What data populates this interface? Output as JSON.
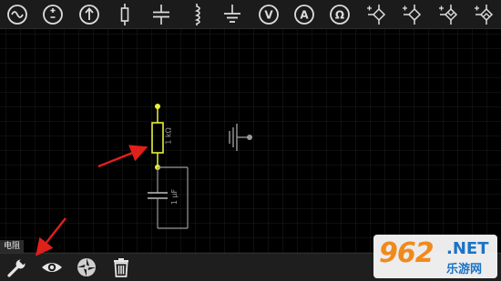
{
  "toolbar": {
    "items": [
      {
        "name": "ac-source-icon"
      },
      {
        "name": "dc-source-icon"
      },
      {
        "name": "current-source-icon"
      },
      {
        "name": "resistor-icon"
      },
      {
        "name": "capacitor-icon"
      },
      {
        "name": "inductor-icon"
      },
      {
        "name": "ground-icon"
      },
      {
        "name": "voltmeter-icon"
      },
      {
        "name": "ammeter-icon"
      },
      {
        "name": "ohmmeter-icon"
      },
      {
        "name": "npn-transistor-icon"
      },
      {
        "name": "pnp-transistor-icon"
      },
      {
        "name": "n-mosfet-icon"
      },
      {
        "name": "p-mosfet-icon"
      }
    ],
    "labels": {
      "voltmeter": "V",
      "ammeter": "A",
      "ohmmeter": "Ω"
    }
  },
  "canvas": {
    "resistor_label": "1 kΩ",
    "capacitor_label": "1 μF"
  },
  "selection": {
    "label": "电阻"
  },
  "bottombar": {
    "items": [
      "settings-wrench-icon",
      "view-eye-icon",
      "rotate-icon",
      "delete-trash-icon"
    ]
  },
  "watermark": {
    "logo": "962",
    "net": ".NET",
    "sub": "乐游网"
  },
  "colors": {
    "node": "#e9f03a",
    "selected": "#e9f03a",
    "wire": "#9a9a9a",
    "arrow": "#e0201b",
    "watermark_orange": "#f08a1c",
    "watermark_blue": "#1a73c7"
  }
}
